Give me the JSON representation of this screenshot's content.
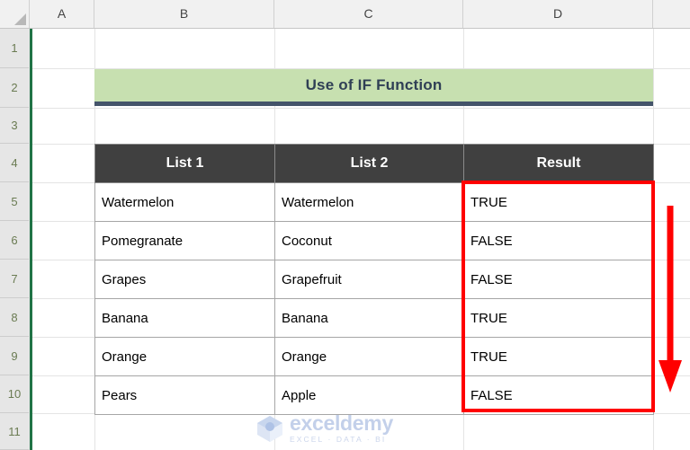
{
  "app": {
    "type": "spreadsheet",
    "accent_color": "#217346"
  },
  "column_headers": [
    "A",
    "B",
    "C",
    "D"
  ],
  "row_headers": [
    "1",
    "2",
    "3",
    "4",
    "5",
    "6",
    "7",
    "8",
    "9",
    "10",
    "11"
  ],
  "title_banner": {
    "text": "Use of IF Function",
    "fill_color": "#c7e0b0",
    "text_color": "#2f3f55",
    "underline_color": "#44546a"
  },
  "table": {
    "headers": [
      "List 1",
      "List 2",
      "Result"
    ],
    "header_fill": "#404040",
    "header_text_color": "#ffffff",
    "rows": [
      [
        "Watermelon",
        "Watermelon",
        "TRUE"
      ],
      [
        "Pomegranate",
        "Coconut",
        "FALSE"
      ],
      [
        "Grapes",
        "Grapefruit",
        "FALSE"
      ],
      [
        "Banana",
        "Banana",
        "TRUE"
      ],
      [
        "Orange",
        "Orange",
        "TRUE"
      ],
      [
        "Pears",
        "Apple",
        "FALSE"
      ]
    ]
  },
  "annotations": {
    "highlight_box": {
      "target_column": "Result",
      "color": "#ff0000"
    },
    "arrow": {
      "direction": "down",
      "color": "#ff0000"
    }
  },
  "watermark": {
    "name": "exceldemy",
    "tagline": "EXCEL · DATA · BI",
    "color": "#c3d0ea"
  }
}
